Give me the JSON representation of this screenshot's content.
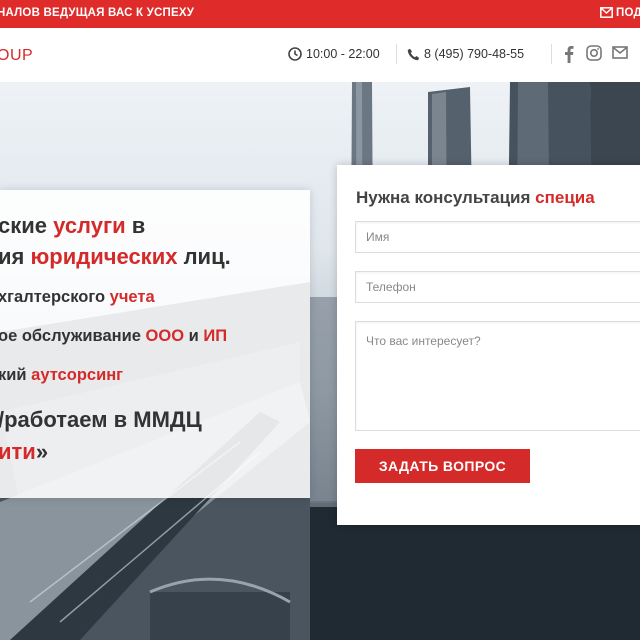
{
  "topbar": {
    "tagline": "НАЛОВ ВЕДУЩАЯ ВАС К УСПЕХУ",
    "subscribe": "ПОД"
  },
  "header": {
    "logo": "OUP",
    "hours": "10:00 - 22:00",
    "phone": "8 (495) 790-48-55",
    "social": [
      "facebook-icon",
      "instagram-icon",
      "email-icon"
    ]
  },
  "hero": {
    "title_line1": {
      "a": "ские ",
      "b": "услуги",
      "c": " в"
    },
    "title_line2": {
      "a": "ия ",
      "b": "юридических",
      "c": " лиц."
    },
    "items": [
      {
        "a": "хгалтерского ",
        "b": "учета",
        "c": ""
      },
      {
        "a": "ое обслуживание ",
        "b": "ООО",
        "c": " и ",
        "d": "ИП"
      },
      {
        "a": "кий ",
        "b": "аутсорсинг",
        "c": ""
      }
    ],
    "office_line1": "/работаем в ММДЦ",
    "office_line2": {
      "b": "ити",
      "c": "»"
    }
  },
  "form": {
    "title_a": "Нужна консультация ",
    "title_b": "специа",
    "name_placeholder": "Имя",
    "phone_placeholder": "Телефон",
    "message_placeholder": "Что вас интересует?",
    "submit": "ЗАДАТЬ ВОПРОС"
  },
  "colors": {
    "accent": "#d42a2a",
    "topbar": "#e02b2b"
  }
}
